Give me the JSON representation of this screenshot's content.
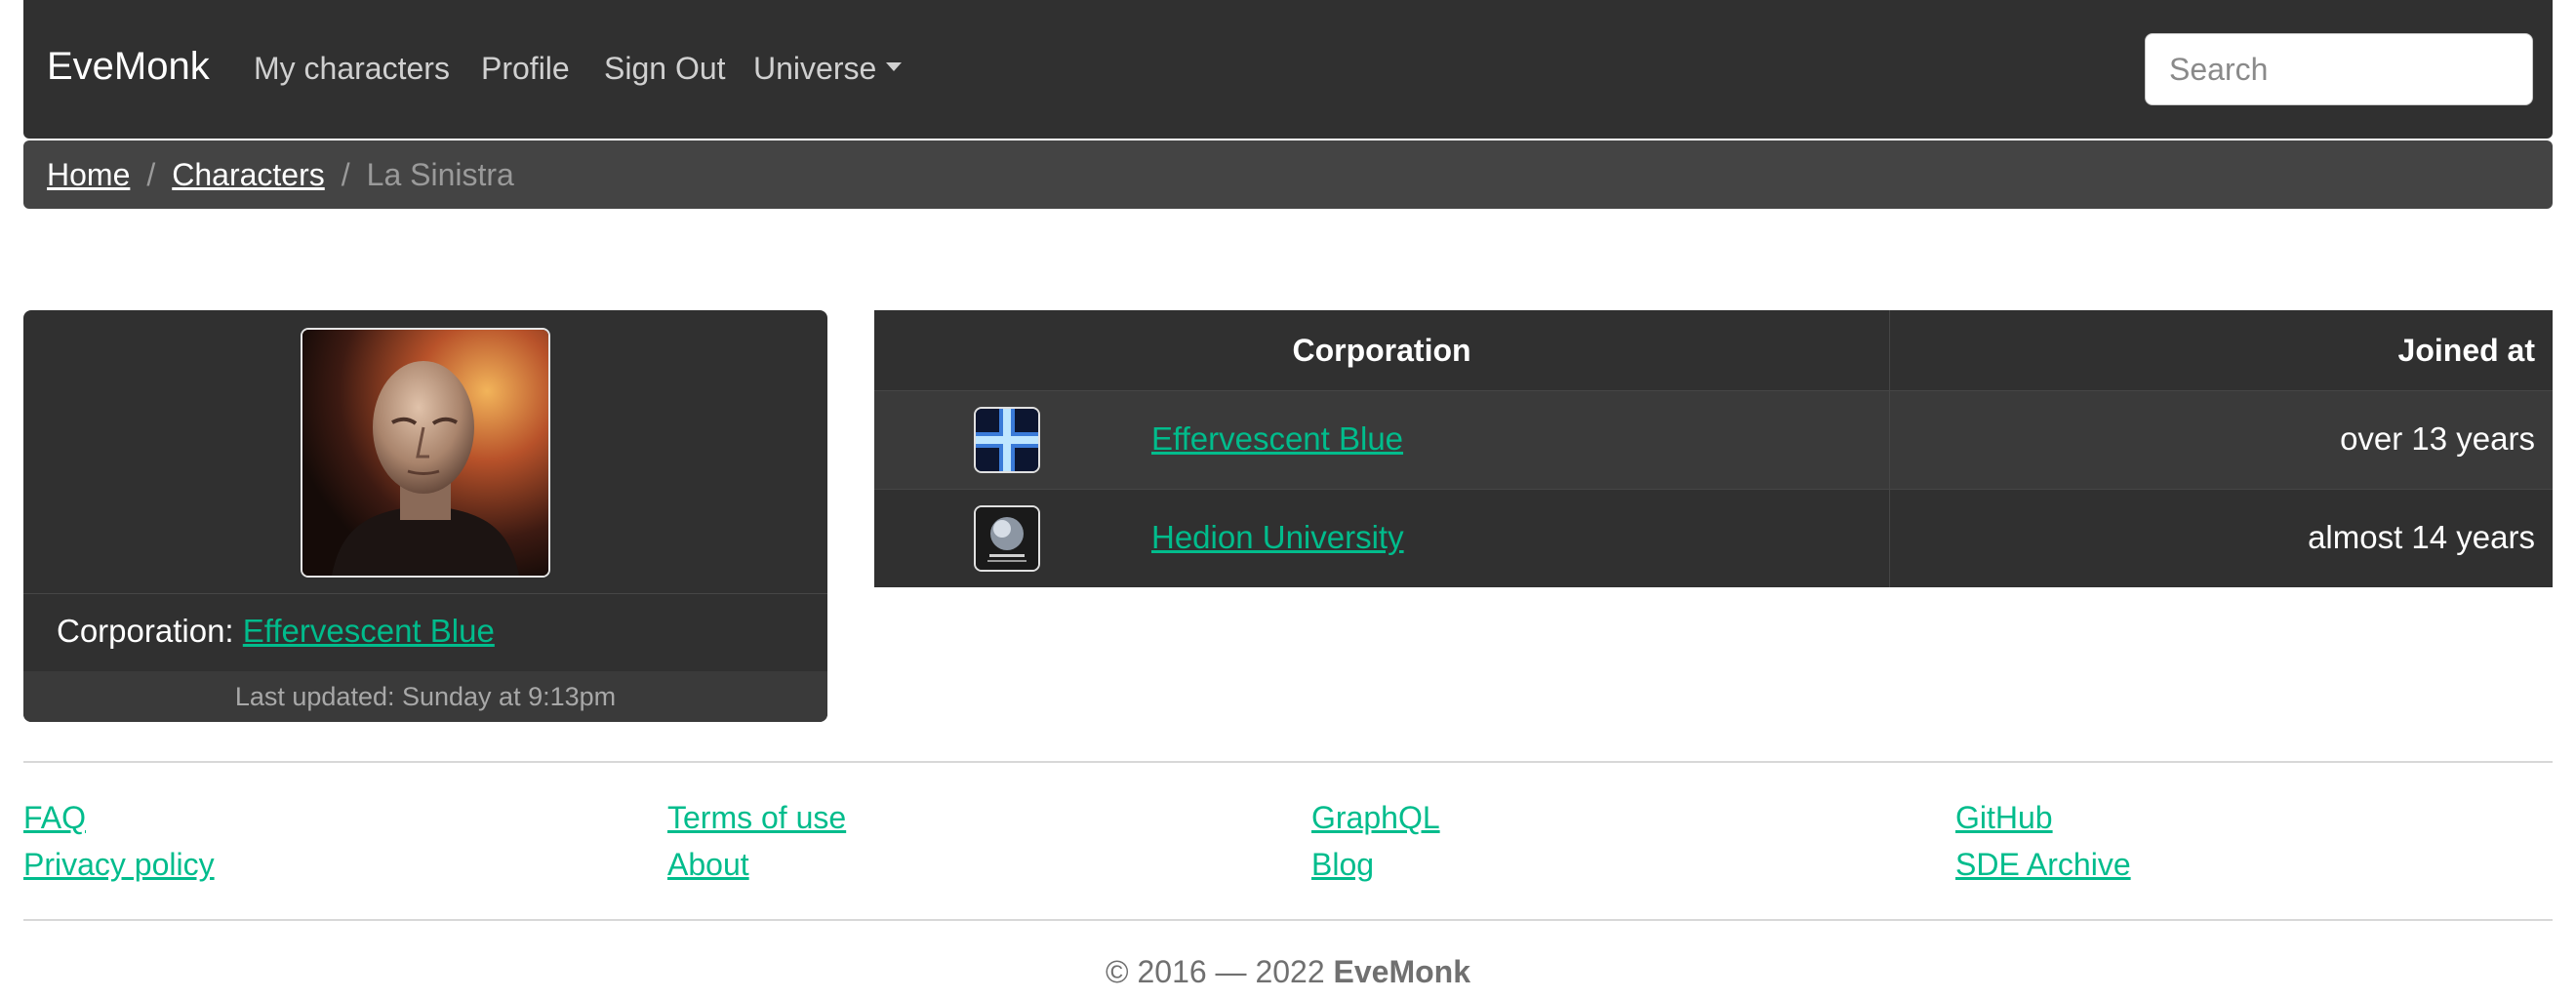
{
  "navbar": {
    "brand": "EveMonk",
    "links": [
      "My characters",
      "Profile",
      "Sign Out",
      "Universe"
    ],
    "search_placeholder": "Search"
  },
  "breadcrumb": {
    "items": [
      "Home",
      "Characters"
    ],
    "separator": "/",
    "active": "La Sinistra"
  },
  "character": {
    "corporation_label": "Corporation:",
    "corporation_name": "Effervescent Blue",
    "last_updated": "Last updated: Sunday at 9:13pm"
  },
  "corporation_history": {
    "headers": [
      "Corporation",
      "Joined at"
    ],
    "rows": [
      {
        "name": "Effervescent Blue",
        "joined": "over 13 years",
        "logo_icon": "blue-cross-logo-icon"
      },
      {
        "name": "Hedion University",
        "joined": "almost 14 years",
        "logo_icon": "hedion-university-logo-icon"
      }
    ]
  },
  "footer": {
    "columns": [
      [
        "FAQ",
        "Privacy policy"
      ],
      [
        "Terms of use",
        "About"
      ],
      [
        "GraphQL",
        "Blog"
      ],
      [
        "GitHub",
        "SDE Archive"
      ]
    ],
    "copyright_prefix": "© 2016 — 2022",
    "copyright_brand": "EveMonk"
  },
  "colors": {
    "navbar_bg": "#303030",
    "breadcrumb_bg": "#444444",
    "link_accent": "#00bc8c"
  }
}
